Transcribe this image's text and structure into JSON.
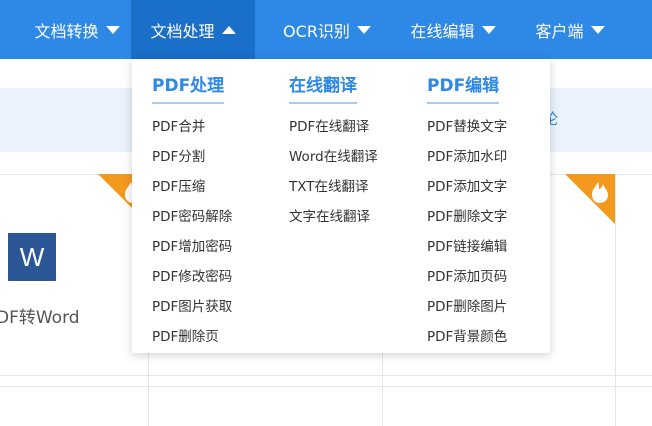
{
  "nav": {
    "items": [
      {
        "label": "文档转换",
        "state": "collapsed"
      },
      {
        "label": "文档处理",
        "state": "expanded"
      },
      {
        "label": "OCR识别",
        "state": "collapsed"
      },
      {
        "label": "在线编辑",
        "state": "collapsed"
      },
      {
        "label": "客户端",
        "state": "collapsed"
      }
    ]
  },
  "background": {
    "band_text": "论",
    "tool_caption": "DF转Word",
    "word_icon_letter": "W"
  },
  "dropdown": {
    "columns": [
      {
        "title": "PDF处理",
        "items": [
          "PDF合并",
          "PDF分割",
          "PDF压缩",
          "PDF密码解除",
          "PDF增加密码",
          "PDF修改密码",
          "PDF图片获取",
          "PDF删除页"
        ]
      },
      {
        "title": "在线翻译",
        "items": [
          "PDF在线翻译",
          "Word在线翻译",
          "TXT在线翻译",
          "文字在线翻译"
        ]
      },
      {
        "title": "PDF编辑",
        "items": [
          "PDF替换文字",
          "PDF添加水印",
          "PDF添加文字",
          "PDF删除文字",
          "PDF链接编辑",
          "PDF添加页码",
          "PDF删除图片",
          "PDF背景颜色"
        ]
      }
    ]
  },
  "colors": {
    "nav_bg": "#2e88e6",
    "nav_active_bg": "#1a6fc8",
    "accent": "#2e88e6",
    "badge_orange": "#f39a1e"
  }
}
